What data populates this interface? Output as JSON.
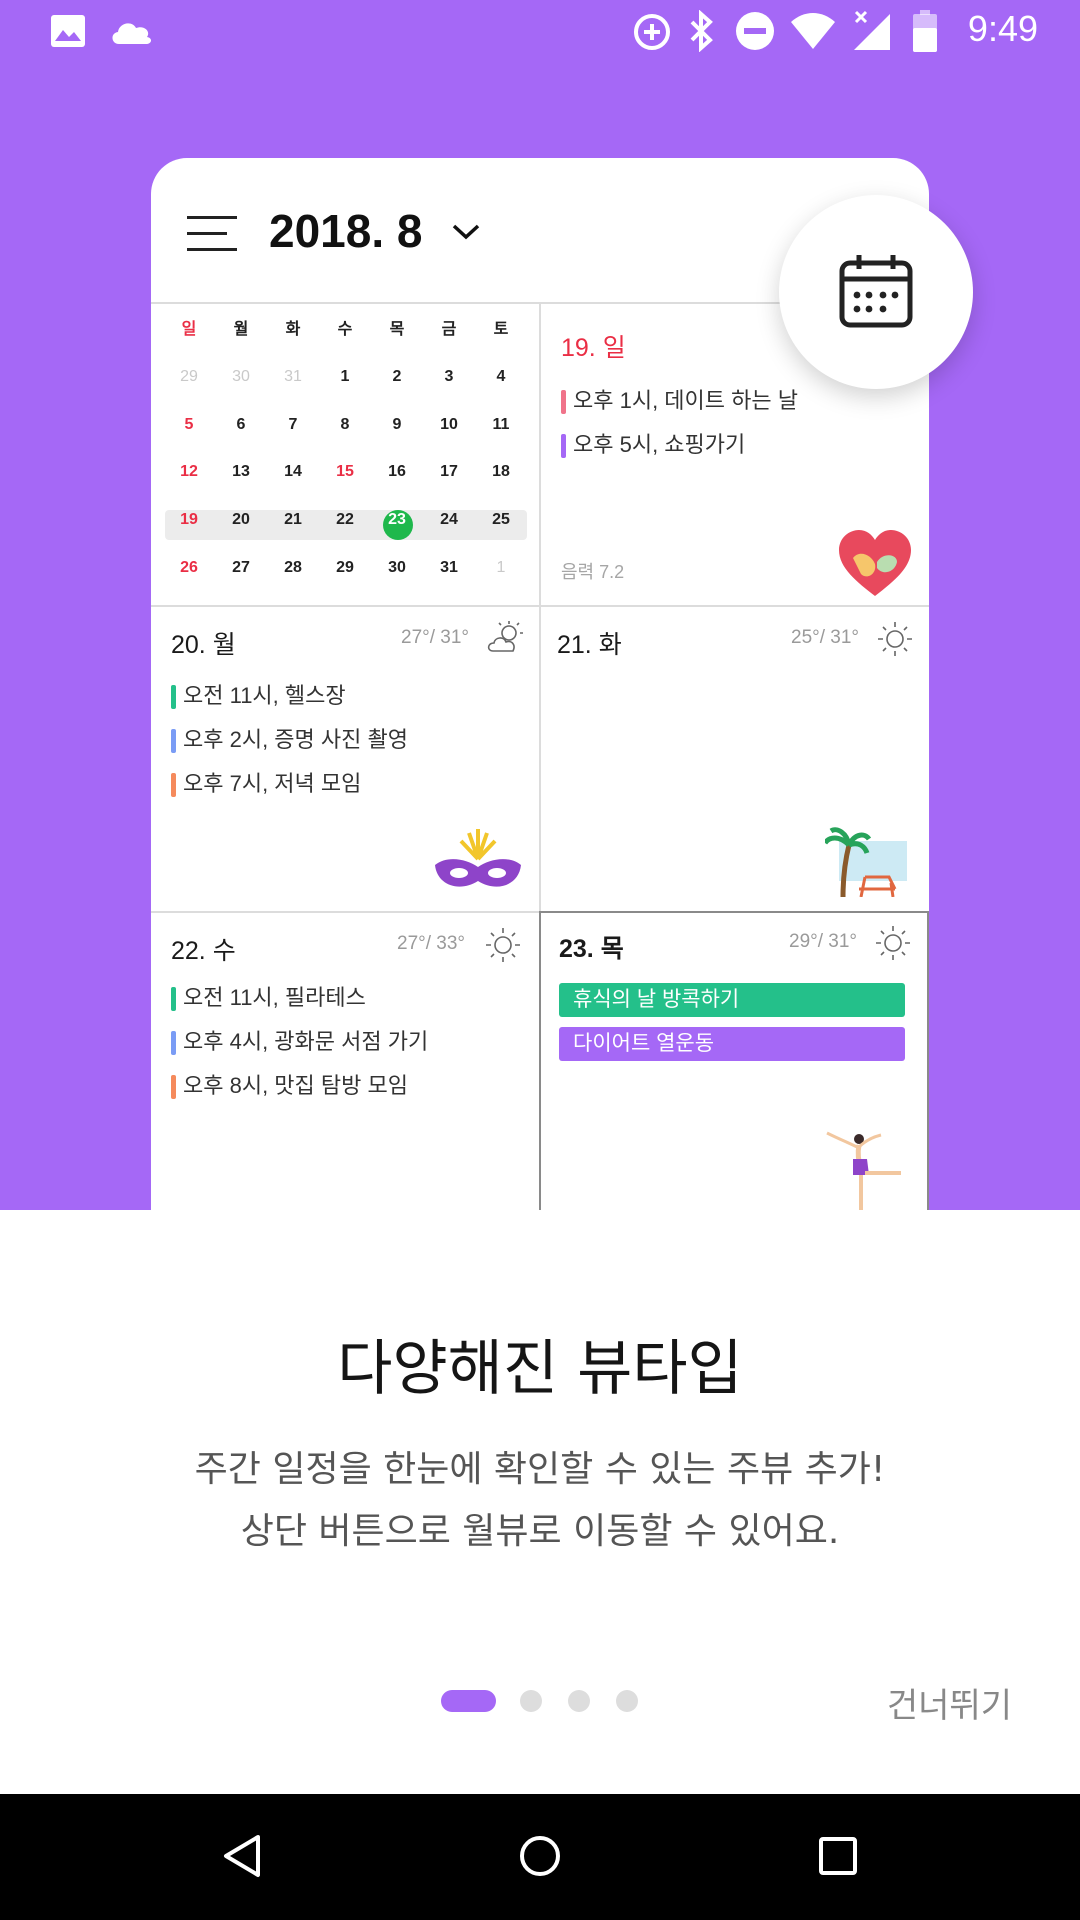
{
  "status_bar": {
    "time": "9:49",
    "icons": [
      "image-icon",
      "cloud-icon",
      "data-saver-icon",
      "bluetooth-icon",
      "do-not-disturb-icon",
      "wifi-icon",
      "signal-icon",
      "battery-icon"
    ]
  },
  "mock": {
    "month_title": "2018. 8",
    "mini_calendar": {
      "weekdays": [
        "일",
        "월",
        "화",
        "수",
        "목",
        "금",
        "토"
      ],
      "weeks": [
        [
          "29",
          "30",
          "31",
          "1",
          "2",
          "3",
          "4"
        ],
        [
          "5",
          "6",
          "7",
          "8",
          "9",
          "10",
          "11"
        ],
        [
          "12",
          "13",
          "14",
          "15",
          "16",
          "17",
          "18"
        ],
        [
          "19",
          "20",
          "21",
          "22",
          "23",
          "24",
          "25"
        ],
        [
          "26",
          "27",
          "28",
          "29",
          "30",
          "31",
          "1"
        ]
      ],
      "today": "23"
    },
    "day_19": {
      "title": "19. 일",
      "events": [
        "오후 1시, 데이트 하는 날",
        "오후 5시, 쇼핑가기"
      ],
      "lunar": "음력 7.2"
    },
    "day_20": {
      "title": "20. 월",
      "temp": "27°/ 31°",
      "events": [
        "오전 11시, 헬스장",
        "오후 2시, 증명 사진 촬영",
        "오후 7시, 저녁 모임"
      ]
    },
    "day_21": {
      "title": "21. 화",
      "temp": "25°/ 31°"
    },
    "day_22": {
      "title": "22. 수",
      "temp": "27°/ 33°",
      "events": [
        "오전 11시, 필라테스",
        "오후 4시, 광화문 서점 가기",
        "오후 8시, 맛집 탐방 모임"
      ]
    },
    "day_23": {
      "title": "23. 목",
      "temp": "29°/ 31°",
      "events": [
        "휴식의 날 방콕하기",
        "다이어트 열운동"
      ]
    }
  },
  "onboarding": {
    "headline": "다양해진 뷰타입",
    "description_line1": "주간 일정을 한눈에 확인할 수 있는 주뷰 추가!",
    "description_line2": "상단 버튼으로 월뷰로 이동할 수 있어요.",
    "skip_label": "건너뛰기",
    "page_count": 4,
    "current_page": 1
  },
  "colors": {
    "accent": "#a568f6",
    "today_green": "#1fb84c",
    "sunday_red": "#ea2e45",
    "event_pink": "#f0738a",
    "event_purple": "#a568f6",
    "event_green": "#24c08a",
    "event_blue": "#7a9cf5",
    "event_orange": "#f58a5c"
  }
}
